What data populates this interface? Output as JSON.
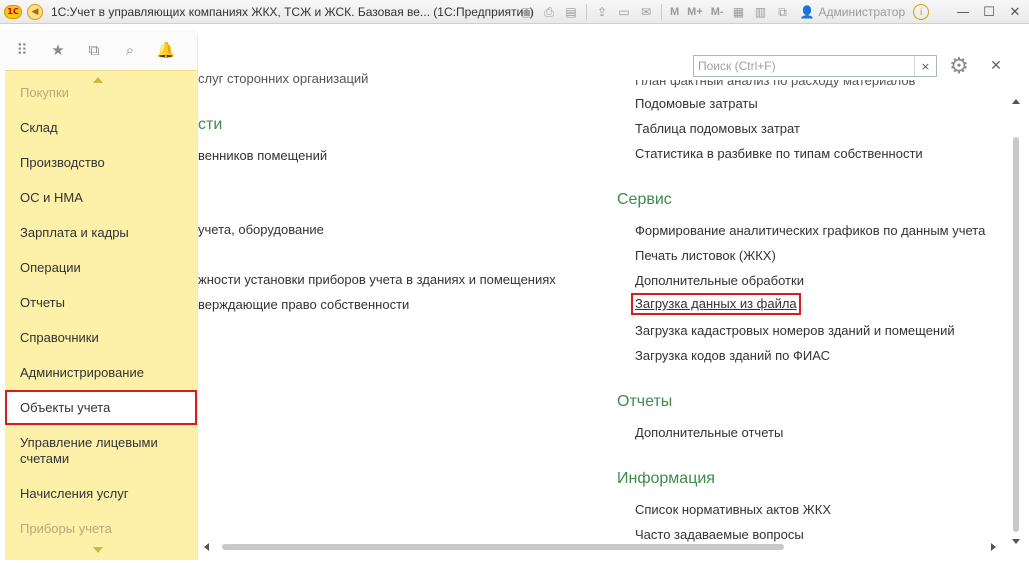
{
  "window": {
    "title": "1С:Учет в управляющих компаниях ЖКХ, ТСЖ и ЖСК. Базовая ве... (1С:Предприятие)",
    "toolbar_m_labels": [
      "M",
      "M+",
      "M-"
    ],
    "user": "Администратор"
  },
  "sidebar": {
    "items": [
      {
        "label": "Покупки"
      },
      {
        "label": "Склад"
      },
      {
        "label": "Производство"
      },
      {
        "label": "ОС и НМА"
      },
      {
        "label": "Зарплата и кадры"
      },
      {
        "label": "Операции"
      },
      {
        "label": "Отчеты"
      },
      {
        "label": "Справочники"
      },
      {
        "label": "Администрирование"
      },
      {
        "label": "Объекты учета"
      },
      {
        "label": "Управление лицевыми счетами"
      },
      {
        "label": "Начисления услуг"
      },
      {
        "label": "Приборы учета"
      }
    ],
    "selected": "Объекты учета"
  },
  "search": {
    "placeholder": "Поиск (Ctrl+F)",
    "value": "",
    "clear_label": "×"
  },
  "left_column": {
    "items": [
      {
        "label": "слуг сторонних организаций"
      },
      {
        "label": "сти"
      },
      {
        "label": "венников помещений"
      },
      {
        "label": "учета, оборудование"
      },
      {
        "label": "жности установки приборов учета в зданиях и помещениях"
      },
      {
        "label": "верждающие право собственности"
      }
    ]
  },
  "right_column": {
    "top_links": [
      {
        "label": "План фактный анализ по расходу материалов"
      },
      {
        "label": "Подомовые затраты"
      },
      {
        "label": "Таблица подомовых затрат"
      },
      {
        "label": "Статистика в разбивке по типам собственности"
      }
    ],
    "sections": [
      {
        "title": "Сервис",
        "links": [
          {
            "label": "Формирование аналитических графиков по данным учета"
          },
          {
            "label": "Печать листовок (ЖКХ)"
          },
          {
            "label": "Дополнительные обработки"
          },
          {
            "label": "Загрузка данных из файла"
          },
          {
            "label": "Загрузка кадастровых номеров зданий и помещений"
          },
          {
            "label": "Загрузка кодов зданий по ФИАС"
          }
        ]
      },
      {
        "title": "Отчеты",
        "links": [
          {
            "label": "Дополнительные отчеты"
          }
        ]
      },
      {
        "title": "Информация",
        "links": [
          {
            "label": "Список нормативных актов ЖКХ"
          },
          {
            "label": "Часто задаваемые вопросы"
          }
        ]
      }
    ]
  },
  "colors": {
    "sidebar_bg": "#fdf0a8",
    "section_title": "#3c8c4a",
    "highlight_border": "#d61c1c"
  },
  "icons": [
    "app-logo-icon",
    "back-icon",
    "save-icon",
    "print-icon",
    "preview-icon",
    "upload-icon",
    "print-icon",
    "mail-icon",
    "calculator-icon",
    "calendar-icon",
    "copy-icon",
    "user-icon",
    "info-icon",
    "minimize-icon",
    "maximize-icon",
    "close-icon",
    "apps-grid-icon",
    "favorites-star-icon",
    "history-icon",
    "search-icon",
    "notifications-bell-icon",
    "settings-gear-icon",
    "close-form-icon"
  ]
}
